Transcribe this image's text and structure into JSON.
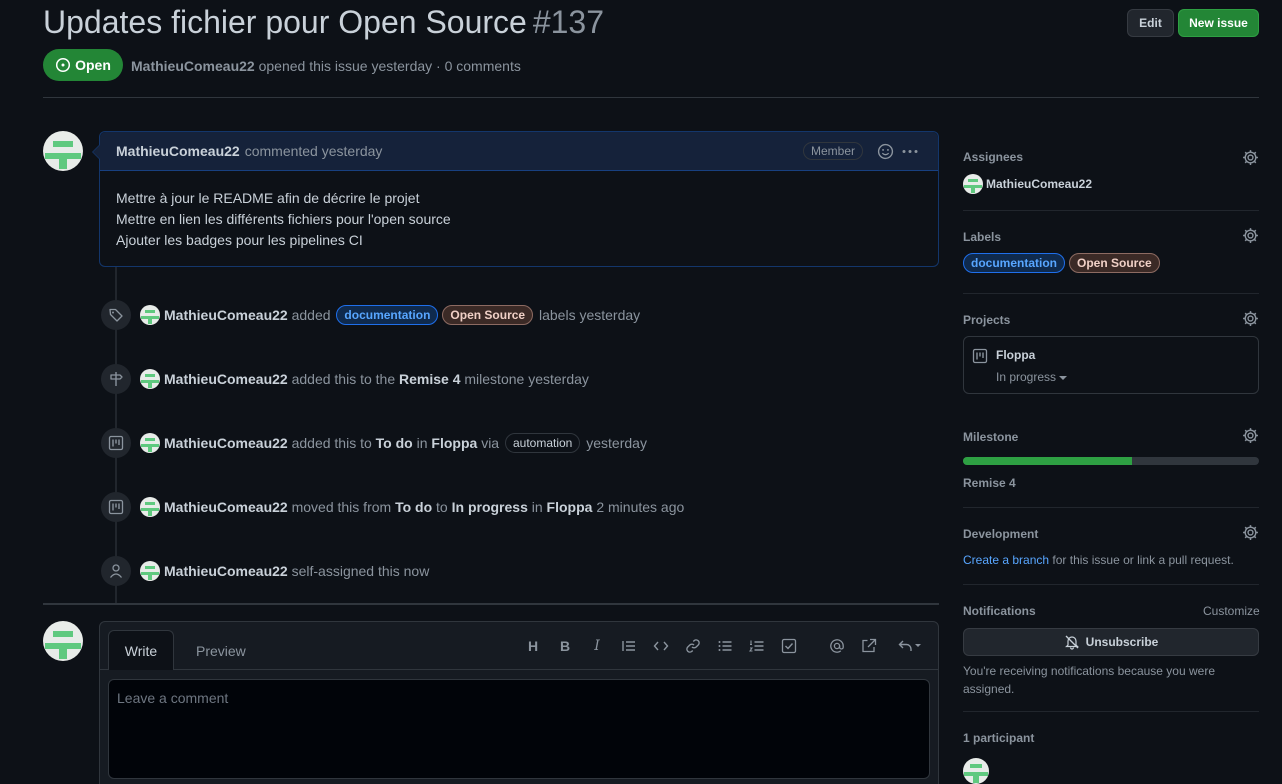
{
  "issue": {
    "title": "Updates fichier pour Open Source",
    "number": "#137",
    "state": "Open",
    "author": "MathieuComeau22",
    "meta_rest": "opened this issue yesterday · 0 comments",
    "edit_label": "Edit",
    "new_issue_label": "New issue"
  },
  "comment": {
    "author": "MathieuComeau22",
    "when": "commented yesterday",
    "badge": "Member",
    "lines": [
      "Mettre à jour le README afin de décrire le projet",
      "Mettre en lien les différents fichiers pour l'open source",
      "Ajouter les badges pour les pipelines CI"
    ]
  },
  "timeline": {
    "user": "MathieuComeau22",
    "labels_event": {
      "text1": "added",
      "label1": "documentation",
      "label2": "Open Source",
      "text2": "labels yesterday"
    },
    "milestone_event": {
      "text1": "added this to the",
      "milestone": "Remise 4",
      "text2": "milestone yesterday"
    },
    "project_event": {
      "text1": "added this to",
      "column": "To do",
      "text2": "in",
      "project": "Floppa",
      "text3": "via",
      "via": "automation",
      "text4": "yesterday"
    },
    "move_event": {
      "text1": "moved this from",
      "from": "To do",
      "text2": "to",
      "to": "In progress",
      "text3": "in",
      "project": "Floppa",
      "text4": "2 minutes ago"
    },
    "assign_event": {
      "text1": "self-assigned this now"
    }
  },
  "editor": {
    "tab_write": "Write",
    "tab_preview": "Preview",
    "placeholder": "Leave a comment",
    "toolbar_icons": [
      "heading-icon",
      "bold-icon",
      "italic-icon",
      "quote-icon",
      "code-icon",
      "link-icon",
      "bulleted-list-icon",
      "numbered-list-icon",
      "task-list-icon",
      "mention-icon",
      "cross-reference-icon",
      "saved-reply-icon"
    ]
  },
  "sidebar": {
    "assignees_title": "Assignees",
    "assignee": "MathieuComeau22",
    "labels_title": "Labels",
    "labels": [
      "documentation",
      "Open Source"
    ],
    "projects_title": "Projects",
    "project_name": "Floppa",
    "project_status": "In progress",
    "milestone_title": "Milestone",
    "milestone_name": "Remise 4",
    "milestone_progress": 0.57,
    "development_title": "Development",
    "dev_link": "Create a branch",
    "dev_rest": "for this issue or link a pull request.",
    "notifications_title": "Notifications",
    "customize": "Customize",
    "unsubscribe": "Unsubscribe",
    "notif_reason_1": "You're receiving notifications because you were",
    "notif_reason_2": "assigned.",
    "participants": "1 participant"
  },
  "colors": {
    "background": "#0d1117",
    "open_green": "#238636",
    "link_blue": "#58a6ff",
    "progress_green": "#2ea043"
  }
}
